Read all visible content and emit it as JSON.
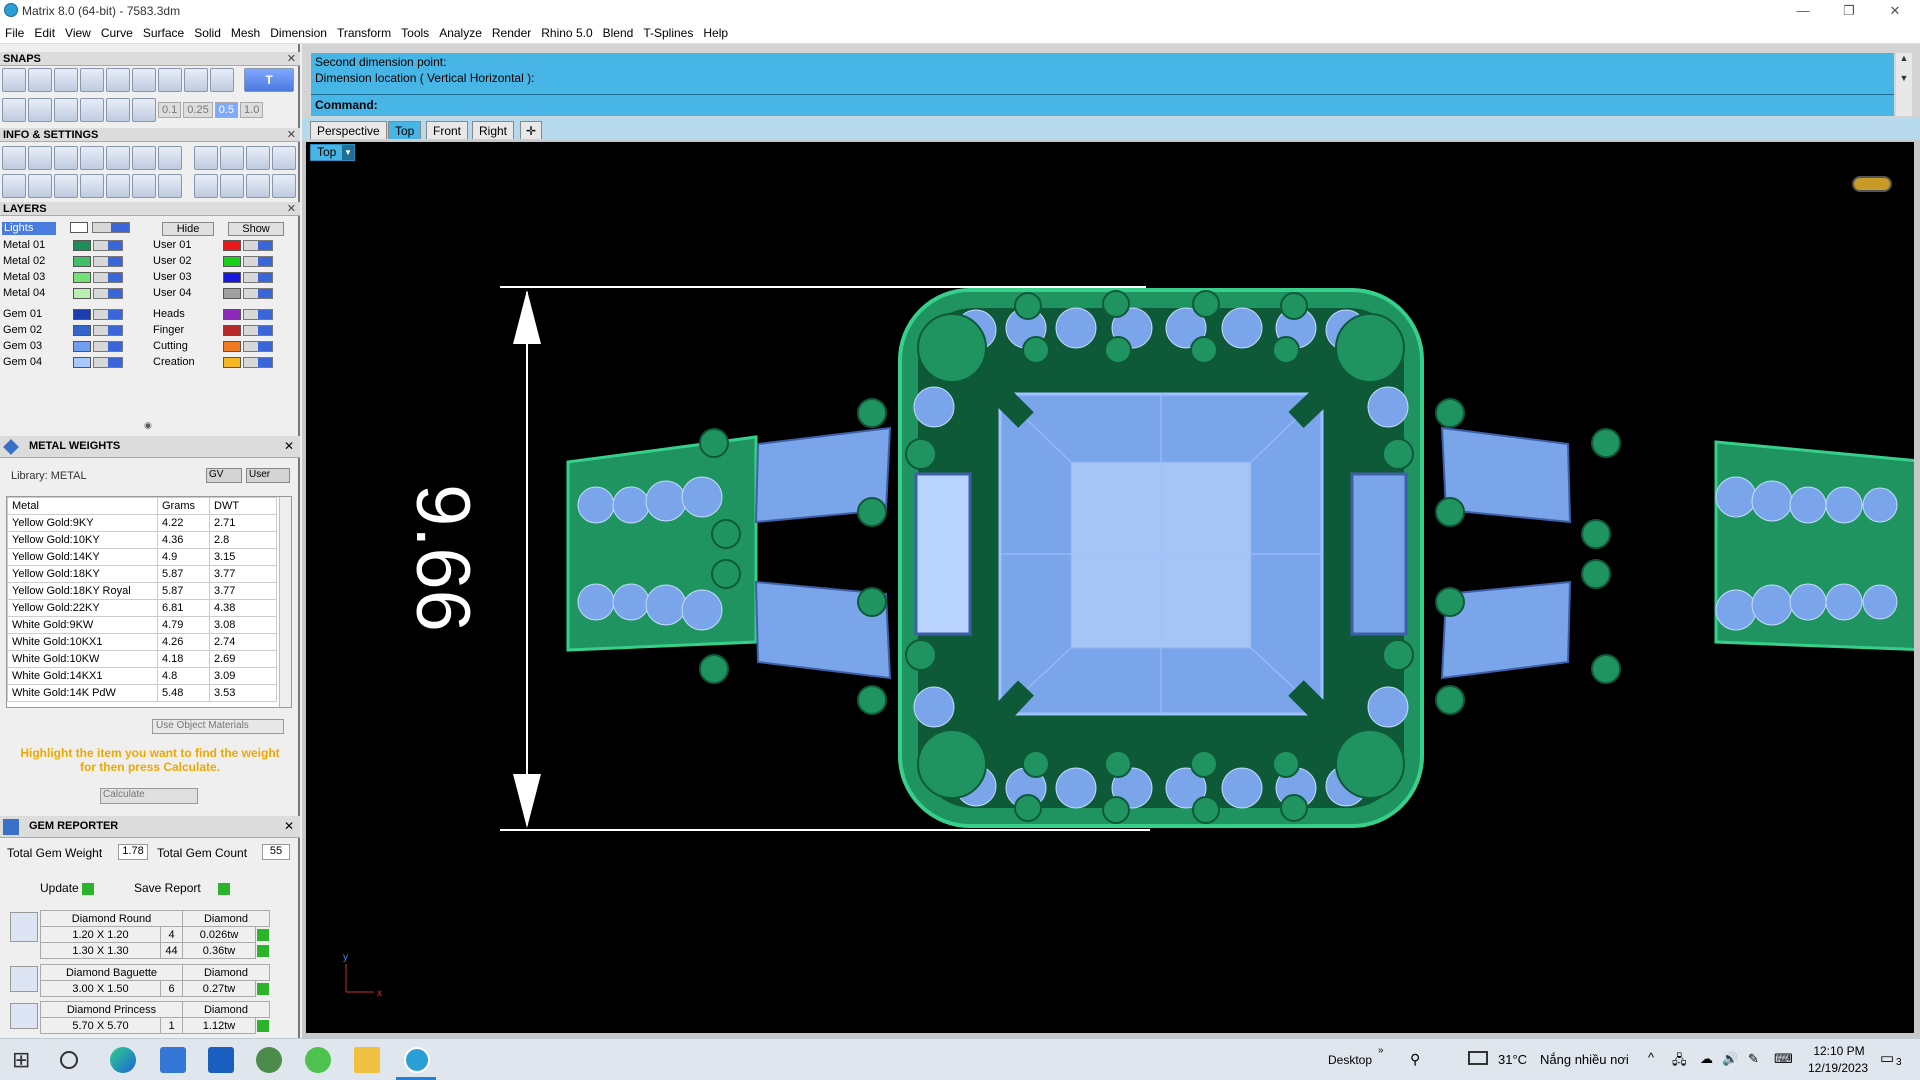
{
  "window": {
    "title": "Matrix 8.0 (64-bit) - 7583.3dm",
    "minimize": "—",
    "restore": "❐",
    "close": "✕"
  },
  "menu": [
    "File",
    "Edit",
    "View",
    "Curve",
    "Surface",
    "Solid",
    "Mesh",
    "Dimension",
    "Transform",
    "Tools",
    "Analyze",
    "Render",
    "Rhino 5.0",
    "Blend",
    "T-Splines",
    "Help"
  ],
  "snaps": {
    "title": "SNAPS",
    "close": "✕",
    "values": [
      "0.1",
      "0.25",
      "0.5",
      "1.0"
    ],
    "active_label": "T"
  },
  "info_settings": {
    "title": "INFO & SETTINGS",
    "close": "✕"
  },
  "layers": {
    "title": "LAYERS",
    "close": "✕",
    "hide": "Hide",
    "show": "Show",
    "lights": "Lights",
    "left": [
      {
        "name": "Metal 01",
        "color": "#1e8c55"
      },
      {
        "name": "Metal 02",
        "color": "#3fbf6a"
      },
      {
        "name": "Metal 03",
        "color": "#73e07a"
      },
      {
        "name": "Metal 04",
        "color": "#b8f0b0"
      },
      {
        "name": "Gem 01",
        "color": "#1a3fae"
      },
      {
        "name": "Gem 02",
        "color": "#3366cc"
      },
      {
        "name": "Gem 03",
        "color": "#6f9ef2"
      },
      {
        "name": "Gem 04",
        "color": "#a8c8ff"
      }
    ],
    "right": [
      {
        "name": "User 01",
        "color": "#e81818"
      },
      {
        "name": "User 02",
        "color": "#17d117"
      },
      {
        "name": "User 03",
        "color": "#1818e0"
      },
      {
        "name": "User 04",
        "color": "#a0a0a0"
      },
      {
        "name": "Heads",
        "color": "#8b28b8"
      },
      {
        "name": "Finger",
        "color": "#b82828"
      },
      {
        "name": "Cutting",
        "color": "#f07820"
      },
      {
        "name": "Creation",
        "color": "#f5b820"
      }
    ]
  },
  "metal_weights": {
    "title": "METAL WEIGHTS",
    "close": "✕",
    "library": "Library: METAL",
    "gv": "GV",
    "user": "User",
    "columns": [
      "Metal",
      "Grams",
      "DWT"
    ],
    "rows": [
      [
        "Yellow Gold:9KY",
        "4.22",
        "2.71"
      ],
      [
        "Yellow Gold:10KY",
        "4.36",
        "2.8"
      ],
      [
        "Yellow Gold:14KY",
        "4.9",
        "3.15"
      ],
      [
        "Yellow Gold:18KY",
        "5.87",
        "3.77"
      ],
      [
        "Yellow Gold:18KY Royal",
        "5.87",
        "3.77"
      ],
      [
        "Yellow Gold:22KY",
        "6.81",
        "4.38"
      ],
      [
        "White Gold:9KW",
        "4.79",
        "3.08"
      ],
      [
        "White Gold:10KX1",
        "4.26",
        "2.74"
      ],
      [
        "White Gold:10KW",
        "4.18",
        "2.69"
      ],
      [
        "White Gold:14KX1",
        "4.8",
        "3.09"
      ],
      [
        "White Gold:14K PdW",
        "5.48",
        "3.53"
      ]
    ],
    "use_object_materials": "Use Object Materials",
    "hint": "Highlight the item you want to find the weight for then press Calculate.",
    "calculate": "Calculate"
  },
  "gem_reporter": {
    "title": "GEM REPORTER",
    "close": "✕",
    "total_weight_label": "Total Gem Weight",
    "total_weight": "1.78",
    "total_count_label": "Total Gem Count",
    "total_count": "55",
    "update": "Update",
    "save_report": "Save Report",
    "groups": [
      {
        "name": "Diamond Round",
        "material": "Diamond",
        "rows": [
          [
            "1.20 X 1.20",
            "4",
            "0.026tw"
          ],
          [
            "1.30 X 1.30",
            "44",
            "0.36tw"
          ]
        ]
      },
      {
        "name": "Diamond Baguette",
        "material": "Diamond",
        "rows": [
          [
            "3.00 X 1.50",
            "6",
            "0.27tw"
          ]
        ]
      },
      {
        "name": "Diamond Princess",
        "material": "Diamond",
        "rows": [
          [
            "5.70 X 5.70",
            "1",
            "1.12tw"
          ]
        ]
      }
    ]
  },
  "command": {
    "line1": "Second dimension point:",
    "line2": "Dimension location ( Vertical  Horizontal ):",
    "prompt": "Command:"
  },
  "viewport_tabs": [
    "Perspective",
    "Top",
    "Front",
    "Right"
  ],
  "active_tab": "Top",
  "viewport_label": "Top",
  "dimension_value": "9.66",
  "axis": {
    "x": "x",
    "y": "y"
  },
  "colors": {
    "metal": "#1f9460",
    "metal_dark": "#0e5a38",
    "gem": "#7aa5ea",
    "gem_light": "#b9d3ff",
    "accent": "#47b6e6"
  },
  "taskbar": {
    "desktop": "Desktop",
    "weather_temp": "31°C",
    "weather_text": "Nắng nhiều nơi",
    "time": "12:10 PM",
    "date": "12/19/2023",
    "notif_count": "3"
  }
}
